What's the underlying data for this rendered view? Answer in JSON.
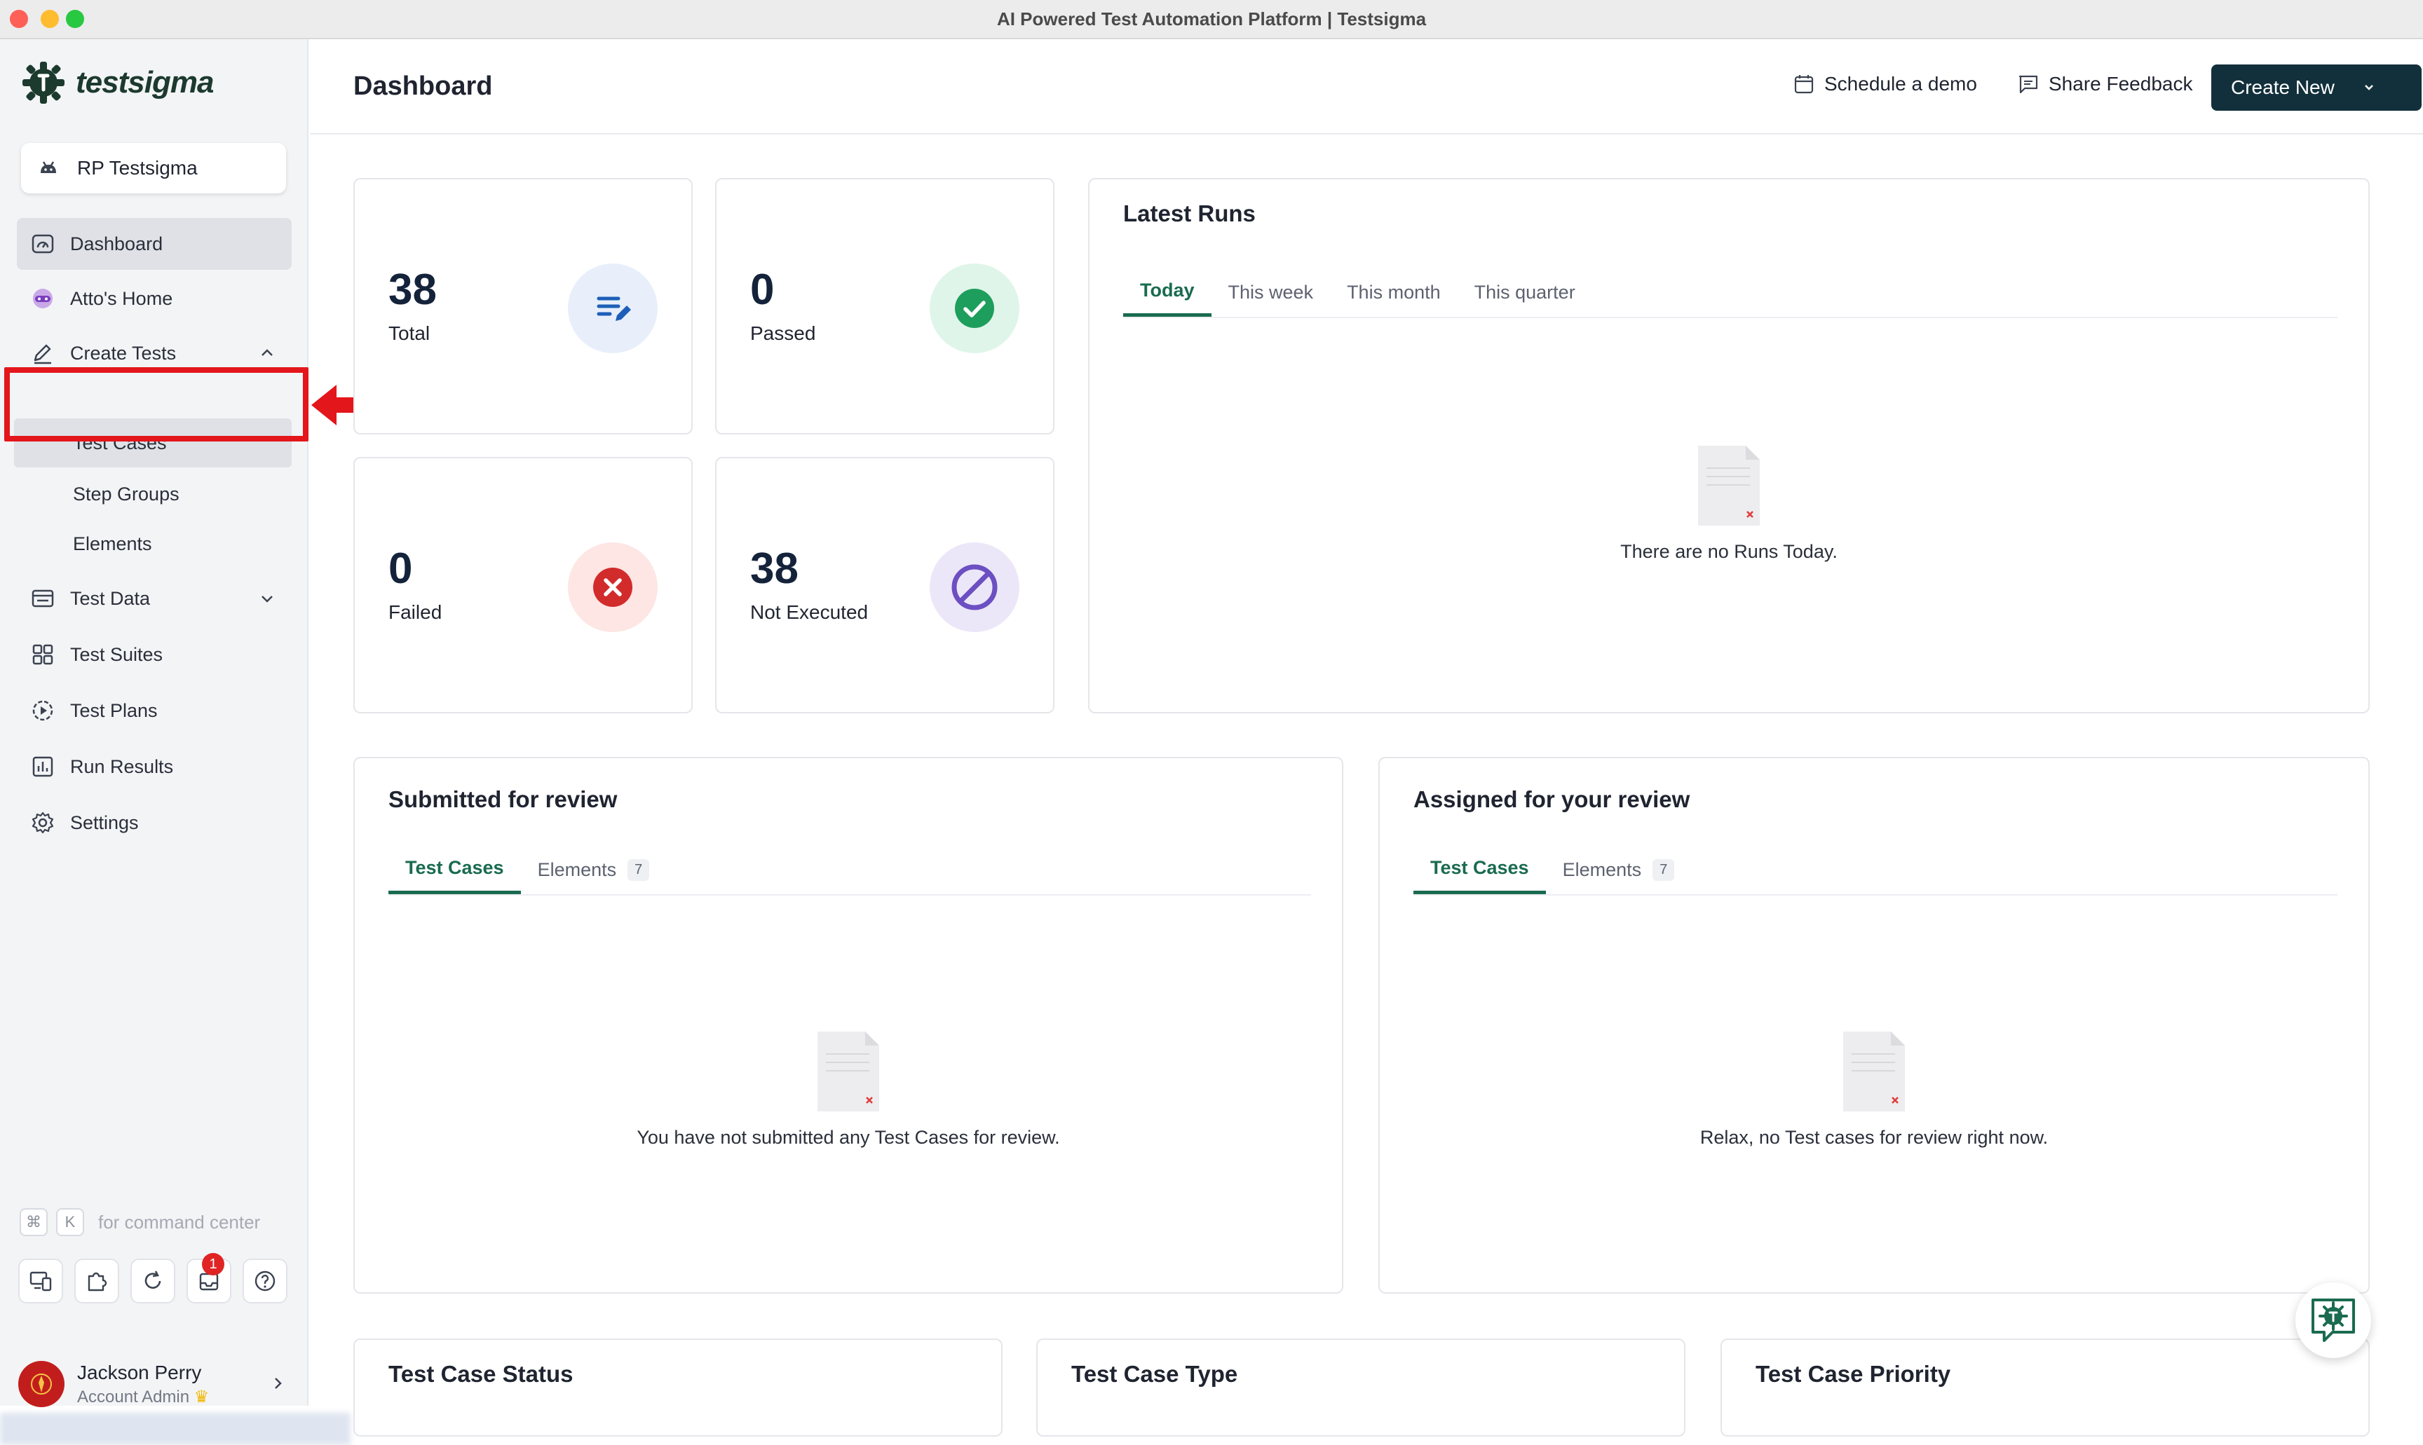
{
  "window": {
    "title": "AI Powered Test Automation Platform | Testsigma"
  },
  "brand": {
    "name": "testsigma"
  },
  "workspace": {
    "name": "RP Testsigma",
    "icon": "android-icon"
  },
  "sidebar": {
    "items": [
      {
        "label": "Dashboard",
        "icon": "dashboard-icon"
      },
      {
        "label": "Atto's Home",
        "icon": "atto-icon"
      },
      {
        "label": "Create Tests",
        "icon": "pencil-icon"
      },
      {
        "label": "Test Cases"
      },
      {
        "label": "Step Groups"
      },
      {
        "label": "Elements"
      },
      {
        "label": "Test Data",
        "icon": "test-data-icon"
      },
      {
        "label": "Test Suites",
        "icon": "grid-icon"
      },
      {
        "label": "Test Plans",
        "icon": "play-circle-icon"
      },
      {
        "label": "Run Results",
        "icon": "bar-chart-icon"
      },
      {
        "label": "Settings",
        "icon": "gear-icon"
      }
    ],
    "command_hint": {
      "key1": "⌘",
      "key2": "K",
      "text": "for command center"
    },
    "notification_count": "1",
    "user": {
      "name": "Jackson Perry",
      "role": "Account Admin"
    }
  },
  "header": {
    "title": "Dashboard",
    "schedule_demo": "Schedule a demo",
    "share_feedback": "Share Feedback",
    "create_new": "Create New"
  },
  "stats": [
    {
      "value": "38",
      "label": "Total",
      "icon": "edit-list-icon",
      "color": "#1d5fb8"
    },
    {
      "value": "0",
      "label": "Passed",
      "icon": "check-circle-icon",
      "color": "#1e9e5c"
    },
    {
      "value": "0",
      "label": "Failed",
      "icon": "x-circle-icon",
      "color": "#d22b2b"
    },
    {
      "value": "38",
      "label": "Not Executed",
      "icon": "ban-icon",
      "color": "#6c4fc2"
    }
  ],
  "latest_runs": {
    "title": "Latest Runs",
    "tabs": [
      "Today",
      "This week",
      "This month",
      "This quarter"
    ],
    "empty_text": "There are no Runs Today."
  },
  "submitted_review": {
    "title": "Submitted for review",
    "tabs": [
      {
        "label": "Test Cases"
      },
      {
        "label": "Elements",
        "count": "7"
      }
    ],
    "empty_text": "You have not submitted any Test Cases for review."
  },
  "assigned_review": {
    "title": "Assigned for your review",
    "tabs": [
      {
        "label": "Test Cases"
      },
      {
        "label": "Elements",
        "count": "7"
      }
    ],
    "empty_text": "Relax, no Test cases for review right now."
  },
  "bottom_cards": [
    "Test Case Status",
    "Test Case Type",
    "Test Case Priority"
  ],
  "colors": {
    "accent": "#1a6b50",
    "primary_button": "#12303b",
    "highlight": "#e3161b"
  }
}
